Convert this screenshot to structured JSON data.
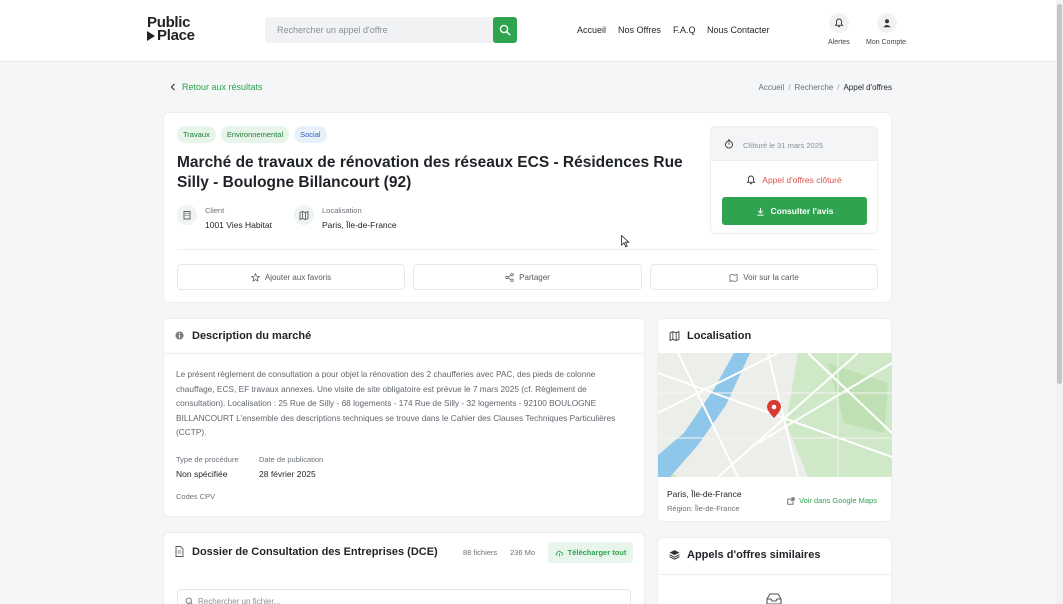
{
  "header": {
    "logo_line1": "Public",
    "logo_line2": "Place",
    "search_placeholder": "Rechercher un appel d'offre",
    "nav": [
      "Accueil",
      "Nos Offres",
      "F.A.Q",
      "Nous Contacter"
    ],
    "alerts_label": "Alertes",
    "account_label": "Mon Compte"
  },
  "breadcrumb": {
    "back_label": "Retour aux résultats",
    "items": [
      "Accueil",
      "Recherche",
      "Appel d'offres"
    ],
    "separator": "/"
  },
  "offer": {
    "tags": [
      "Travaux",
      "Environnemental",
      "Social"
    ],
    "title": "Marché de travaux de rénovation des réseaux ECS - Résidences Rue Silly - Boulogne Billancourt (92)",
    "client_label": "Client",
    "client_value": "1001 Vies Habitat",
    "location_label": "Localisation",
    "location_value": "Paris, Île-de-France",
    "closing_date": "Clôturé le 31 mars 2025",
    "status": "Appel d'offres clôturé",
    "consult_button": "Consulter l'avis",
    "actions": [
      "Ajouter aux favoris",
      "Partager",
      "Voir sur la carte"
    ]
  },
  "description": {
    "title": "Description du marché",
    "text": "Le présent règlement de consultation a pour objet la rénovation des 2 chaufferies avec PAC, des pieds de colonne chauffage, ECS, EF travaux annexes. Une visite de site obligatoire est prévue le 7 mars 2025 (cf. Règlement de consultation). Localisation : 25 Rue de Silly - 68 logements - 174 Rue de Silly - 32 logements - 92100 BOULOGNE BILLANCOURT L'ensemble des descriptions techniques se trouve dans le Cahier des Clauses Techniques Particulières (CCTP).",
    "procedure_label": "Type de procédure",
    "procedure_value": "Non spécifiée",
    "pub_date_label": "Date de publication",
    "pub_date_value": "28 février 2025",
    "cpv_label": "Codes CPV"
  },
  "localisation": {
    "title": "Localisation",
    "place": "Paris, Île-de-France",
    "region": "Région: Île-de-France",
    "maps_link": "Voir dans Google Maps"
  },
  "dce": {
    "title": "Dossier de Consultation des Entreprises (DCE)",
    "file_count": "88 fichiers",
    "size": "236 Mo",
    "download_all": "Télécharger tout",
    "search_placeholder": "Rechercher un fichier..."
  },
  "similar": {
    "title": "Appels d'offres similaires"
  },
  "colors": {
    "accent": "#2ea44f",
    "closed_red": "#d9534f",
    "tag_blue": "#2b63b5"
  }
}
